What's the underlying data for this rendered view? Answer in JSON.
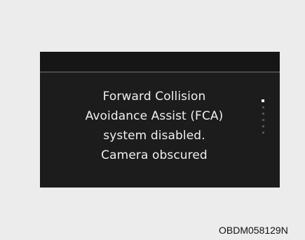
{
  "display": {
    "message_lines": [
      "Forward Collision",
      "Avoidance Assist (FCA)",
      "system disabled.",
      "Camera obscured"
    ],
    "page_indicator": {
      "total": 6,
      "active_index": 0
    }
  },
  "figure_code": "OBDM058129N",
  "colors": {
    "background": "#ececec",
    "screen": "#1c1c1c",
    "text": "#f0f0f0"
  }
}
